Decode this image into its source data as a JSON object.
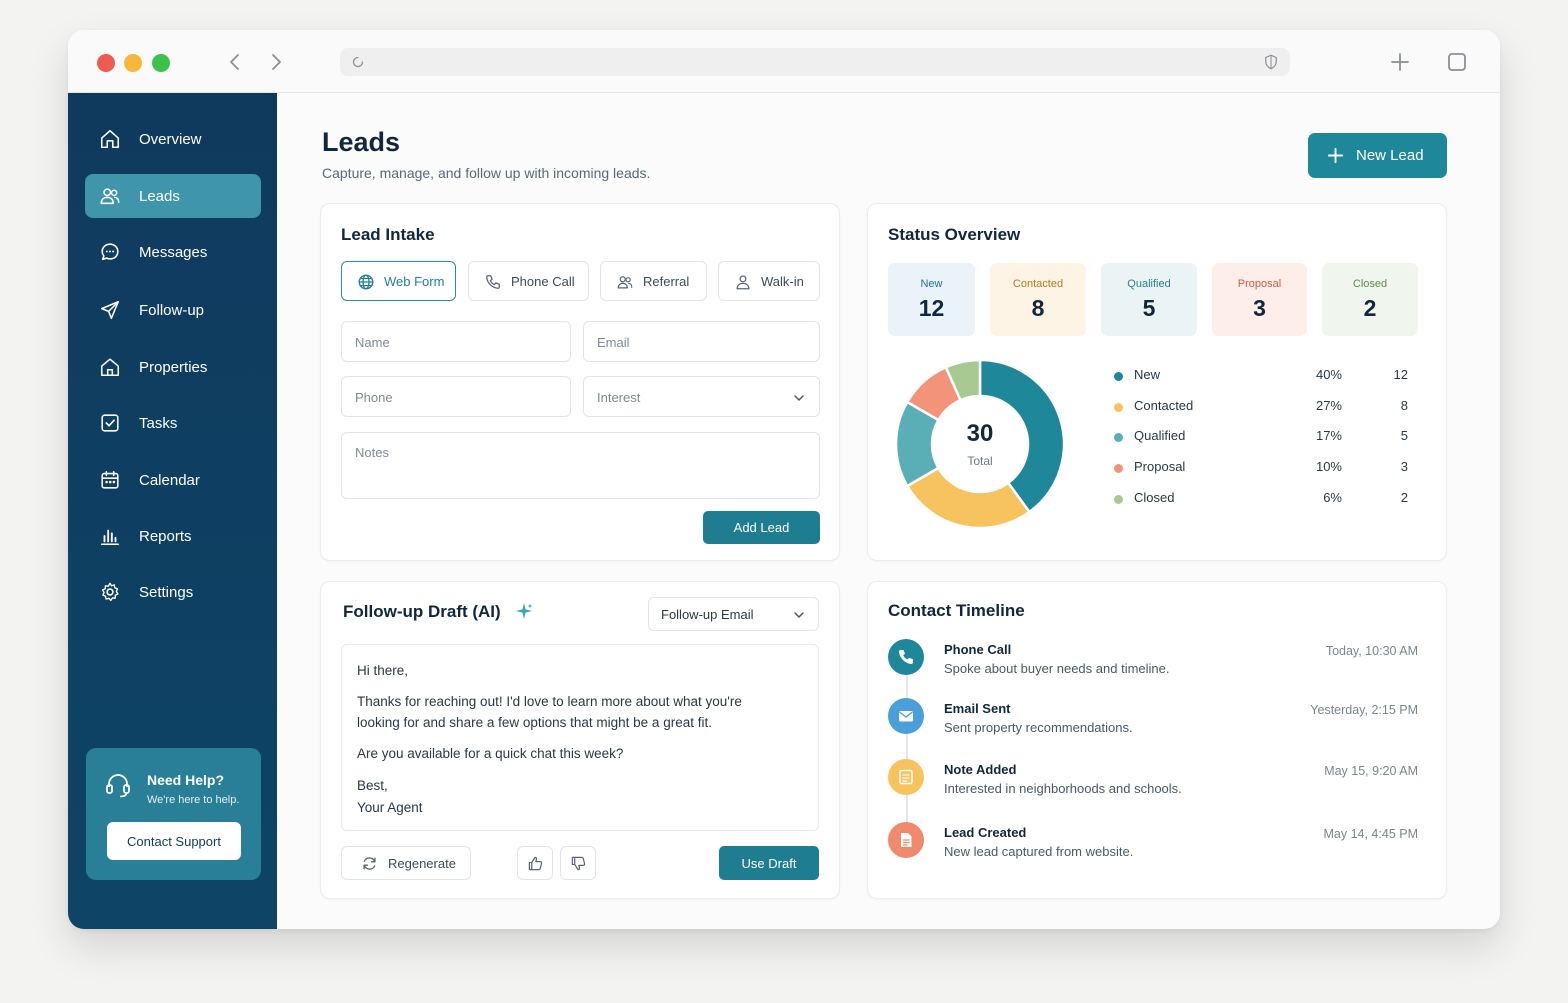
{
  "sidebar": {
    "items": [
      {
        "label": "Overview",
        "icon": "home-icon"
      },
      {
        "label": "Leads",
        "icon": "users-icon"
      },
      {
        "label": "Messages",
        "icon": "chat-icon"
      },
      {
        "label": "Follow-up",
        "icon": "send-icon"
      },
      {
        "label": "Properties",
        "icon": "house-icon"
      },
      {
        "label": "Tasks",
        "icon": "checkbox-icon"
      },
      {
        "label": "Calendar",
        "icon": "calendar-icon"
      },
      {
        "label": "Reports",
        "icon": "bar-chart-icon"
      },
      {
        "label": "Settings",
        "icon": "gear-icon"
      }
    ],
    "active": "Leads",
    "help": {
      "title": "Need Help?",
      "subtitle": "We're here to help.",
      "button": "Contact Support"
    }
  },
  "header": {
    "title": "Leads",
    "subtitle": "Capture, manage, and follow up with incoming leads.",
    "new_button": "New Lead"
  },
  "intake": {
    "title": "Lead Intake",
    "sources": [
      "Web Form",
      "Phone Call",
      "Referral",
      "Walk-in"
    ],
    "active_source": "Web Form",
    "fields": {
      "name": "Name",
      "email": "Email",
      "phone": "Phone",
      "interest": "Interest",
      "notes": "Notes"
    },
    "add_button": "Add Lead"
  },
  "status": {
    "title": "Status Overview",
    "cards": [
      {
        "label": "New",
        "value": "12",
        "bg": "#eaf3f9",
        "fg": "#1f6f9a"
      },
      {
        "label": "Contacted",
        "value": "8",
        "bg": "#fdf4e6",
        "fg": "#b27a1e"
      },
      {
        "label": "Qualified",
        "value": "5",
        "bg": "#eaf4f5",
        "fg": "#2a7f8e"
      },
      {
        "label": "Proposal",
        "value": "3",
        "bg": "#fdeeea",
        "fg": "#cc5a45"
      },
      {
        "label": "Closed",
        "value": "2",
        "bg": "#f0f5ee",
        "fg": "#5f8a50"
      }
    ],
    "total": "30",
    "total_label": "Total"
  },
  "chart_data": {
    "type": "pie",
    "categories": [
      "New",
      "Contacted",
      "Qualified",
      "Proposal",
      "Closed"
    ],
    "values": [
      12,
      8,
      5,
      3,
      2
    ],
    "percent_labels": [
      "40%",
      "27%",
      "17%",
      "10%",
      "6%"
    ],
    "colors": [
      "#1f879a",
      "#f6c35e",
      "#5aaeb6",
      "#f3937a",
      "#a8c98f"
    ]
  },
  "draft": {
    "title": "Follow-up Draft (AI)",
    "template": "Follow-up Email",
    "lines": {
      "greeting": "Hi there,",
      "line1": "Thanks for reaching out! I'd love to learn more about what you're",
      "line2": "looking for and share a few options that might be a great fit.",
      "line3": "Are you available for a quick chat this week?",
      "signoff": "Best,",
      "signature": "Your Agent"
    },
    "regenerate": "Regenerate",
    "use_button": "Use Draft"
  },
  "timeline": {
    "title": "Contact Timeline",
    "items": [
      {
        "title": "Phone Call",
        "desc": "Spoke about buyer needs and timeline.",
        "time": "Today, 10:30 AM",
        "icon": "phone-icon",
        "color": "#1f879a"
      },
      {
        "title": "Email Sent",
        "desc": "Sent property recommendations.",
        "time": "Yesterday, 2:15 PM",
        "icon": "mail-icon",
        "color": "#4a9fd8"
      },
      {
        "title": "Note Added",
        "desc": "Interested in neighborhoods and schools.",
        "time": "May 15, 9:20 AM",
        "icon": "note-icon",
        "color": "#f6c35e"
      },
      {
        "title": "Lead Created",
        "desc": "New lead captured from website.",
        "time": "May 14, 4:45 PM",
        "icon": "document-icon",
        "color": "#ef8a6d"
      }
    ]
  }
}
